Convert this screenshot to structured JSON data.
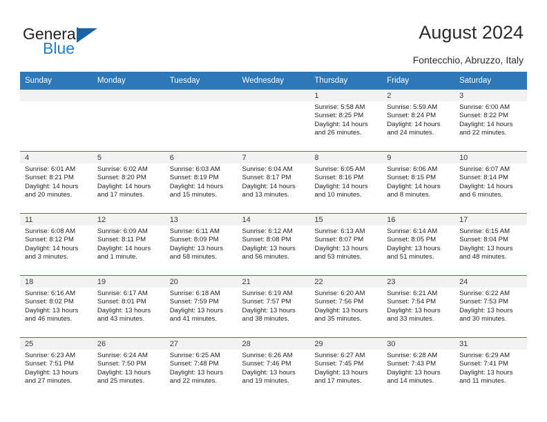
{
  "brand": {
    "name_part1": "General",
    "name_part2": "Blue",
    "accent_color": "#1f7ec4",
    "triangle_color": "#1563a8"
  },
  "header": {
    "title": "August 2024",
    "subtitle": "Fontecchio, Abruzzo, Italy"
  },
  "calendar": {
    "header_bg": "#2e78b8",
    "daynum_bg": "#f2f2f2",
    "weekday_headers": [
      "Sunday",
      "Monday",
      "Tuesday",
      "Wednesday",
      "Thursday",
      "Friday",
      "Saturday"
    ],
    "labels": {
      "sunrise": "Sunrise:",
      "sunset": "Sunset:",
      "daylight": "Daylight:"
    },
    "weeks": [
      [
        {
          "day": "",
          "sunrise": "",
          "sunset": "",
          "daylight_line1": "",
          "daylight_line2": ""
        },
        {
          "day": "",
          "sunrise": "",
          "sunset": "",
          "daylight_line1": "",
          "daylight_line2": ""
        },
        {
          "day": "",
          "sunrise": "",
          "sunset": "",
          "daylight_line1": "",
          "daylight_line2": ""
        },
        {
          "day": "",
          "sunrise": "",
          "sunset": "",
          "daylight_line1": "",
          "daylight_line2": ""
        },
        {
          "day": "1",
          "sunrise": "Sunrise: 5:58 AM",
          "sunset": "Sunset: 8:25 PM",
          "daylight_line1": "Daylight: 14 hours",
          "daylight_line2": "and 26 minutes."
        },
        {
          "day": "2",
          "sunrise": "Sunrise: 5:59 AM",
          "sunset": "Sunset: 8:24 PM",
          "daylight_line1": "Daylight: 14 hours",
          "daylight_line2": "and 24 minutes."
        },
        {
          "day": "3",
          "sunrise": "Sunrise: 6:00 AM",
          "sunset": "Sunset: 8:22 PM",
          "daylight_line1": "Daylight: 14 hours",
          "daylight_line2": "and 22 minutes."
        }
      ],
      [
        {
          "day": "4",
          "sunrise": "Sunrise: 6:01 AM",
          "sunset": "Sunset: 8:21 PM",
          "daylight_line1": "Daylight: 14 hours",
          "daylight_line2": "and 20 minutes."
        },
        {
          "day": "5",
          "sunrise": "Sunrise: 6:02 AM",
          "sunset": "Sunset: 8:20 PM",
          "daylight_line1": "Daylight: 14 hours",
          "daylight_line2": "and 17 minutes."
        },
        {
          "day": "6",
          "sunrise": "Sunrise: 6:03 AM",
          "sunset": "Sunset: 8:19 PM",
          "daylight_line1": "Daylight: 14 hours",
          "daylight_line2": "and 15 minutes."
        },
        {
          "day": "7",
          "sunrise": "Sunrise: 6:04 AM",
          "sunset": "Sunset: 8:17 PM",
          "daylight_line1": "Daylight: 14 hours",
          "daylight_line2": "and 13 minutes."
        },
        {
          "day": "8",
          "sunrise": "Sunrise: 6:05 AM",
          "sunset": "Sunset: 8:16 PM",
          "daylight_line1": "Daylight: 14 hours",
          "daylight_line2": "and 10 minutes."
        },
        {
          "day": "9",
          "sunrise": "Sunrise: 6:06 AM",
          "sunset": "Sunset: 8:15 PM",
          "daylight_line1": "Daylight: 14 hours",
          "daylight_line2": "and 8 minutes."
        },
        {
          "day": "10",
          "sunrise": "Sunrise: 6:07 AM",
          "sunset": "Sunset: 8:14 PM",
          "daylight_line1": "Daylight: 14 hours",
          "daylight_line2": "and 6 minutes."
        }
      ],
      [
        {
          "day": "11",
          "sunrise": "Sunrise: 6:08 AM",
          "sunset": "Sunset: 8:12 PM",
          "daylight_line1": "Daylight: 14 hours",
          "daylight_line2": "and 3 minutes."
        },
        {
          "day": "12",
          "sunrise": "Sunrise: 6:09 AM",
          "sunset": "Sunset: 8:11 PM",
          "daylight_line1": "Daylight: 14 hours",
          "daylight_line2": "and 1 minute."
        },
        {
          "day": "13",
          "sunrise": "Sunrise: 6:11 AM",
          "sunset": "Sunset: 8:09 PM",
          "daylight_line1": "Daylight: 13 hours",
          "daylight_line2": "and 58 minutes."
        },
        {
          "day": "14",
          "sunrise": "Sunrise: 6:12 AM",
          "sunset": "Sunset: 8:08 PM",
          "daylight_line1": "Daylight: 13 hours",
          "daylight_line2": "and 56 minutes."
        },
        {
          "day": "15",
          "sunrise": "Sunrise: 6:13 AM",
          "sunset": "Sunset: 8:07 PM",
          "daylight_line1": "Daylight: 13 hours",
          "daylight_line2": "and 53 minutes."
        },
        {
          "day": "16",
          "sunrise": "Sunrise: 6:14 AM",
          "sunset": "Sunset: 8:05 PM",
          "daylight_line1": "Daylight: 13 hours",
          "daylight_line2": "and 51 minutes."
        },
        {
          "day": "17",
          "sunrise": "Sunrise: 6:15 AM",
          "sunset": "Sunset: 8:04 PM",
          "daylight_line1": "Daylight: 13 hours",
          "daylight_line2": "and 48 minutes."
        }
      ],
      [
        {
          "day": "18",
          "sunrise": "Sunrise: 6:16 AM",
          "sunset": "Sunset: 8:02 PM",
          "daylight_line1": "Daylight: 13 hours",
          "daylight_line2": "and 46 minutes."
        },
        {
          "day": "19",
          "sunrise": "Sunrise: 6:17 AM",
          "sunset": "Sunset: 8:01 PM",
          "daylight_line1": "Daylight: 13 hours",
          "daylight_line2": "and 43 minutes."
        },
        {
          "day": "20",
          "sunrise": "Sunrise: 6:18 AM",
          "sunset": "Sunset: 7:59 PM",
          "daylight_line1": "Daylight: 13 hours",
          "daylight_line2": "and 41 minutes."
        },
        {
          "day": "21",
          "sunrise": "Sunrise: 6:19 AM",
          "sunset": "Sunset: 7:57 PM",
          "daylight_line1": "Daylight: 13 hours",
          "daylight_line2": "and 38 minutes."
        },
        {
          "day": "22",
          "sunrise": "Sunrise: 6:20 AM",
          "sunset": "Sunset: 7:56 PM",
          "daylight_line1": "Daylight: 13 hours",
          "daylight_line2": "and 35 minutes."
        },
        {
          "day": "23",
          "sunrise": "Sunrise: 6:21 AM",
          "sunset": "Sunset: 7:54 PM",
          "daylight_line1": "Daylight: 13 hours",
          "daylight_line2": "and 33 minutes."
        },
        {
          "day": "24",
          "sunrise": "Sunrise: 6:22 AM",
          "sunset": "Sunset: 7:53 PM",
          "daylight_line1": "Daylight: 13 hours",
          "daylight_line2": "and 30 minutes."
        }
      ],
      [
        {
          "day": "25",
          "sunrise": "Sunrise: 6:23 AM",
          "sunset": "Sunset: 7:51 PM",
          "daylight_line1": "Daylight: 13 hours",
          "daylight_line2": "and 27 minutes."
        },
        {
          "day": "26",
          "sunrise": "Sunrise: 6:24 AM",
          "sunset": "Sunset: 7:50 PM",
          "daylight_line1": "Daylight: 13 hours",
          "daylight_line2": "and 25 minutes."
        },
        {
          "day": "27",
          "sunrise": "Sunrise: 6:25 AM",
          "sunset": "Sunset: 7:48 PM",
          "daylight_line1": "Daylight: 13 hours",
          "daylight_line2": "and 22 minutes."
        },
        {
          "day": "28",
          "sunrise": "Sunrise: 6:26 AM",
          "sunset": "Sunset: 7:46 PM",
          "daylight_line1": "Daylight: 13 hours",
          "daylight_line2": "and 19 minutes."
        },
        {
          "day": "29",
          "sunrise": "Sunrise: 6:27 AM",
          "sunset": "Sunset: 7:45 PM",
          "daylight_line1": "Daylight: 13 hours",
          "daylight_line2": "and 17 minutes."
        },
        {
          "day": "30",
          "sunrise": "Sunrise: 6:28 AM",
          "sunset": "Sunset: 7:43 PM",
          "daylight_line1": "Daylight: 13 hours",
          "daylight_line2": "and 14 minutes."
        },
        {
          "day": "31",
          "sunrise": "Sunrise: 6:29 AM",
          "sunset": "Sunset: 7:41 PM",
          "daylight_line1": "Daylight: 13 hours",
          "daylight_line2": "and 11 minutes."
        }
      ]
    ]
  }
}
